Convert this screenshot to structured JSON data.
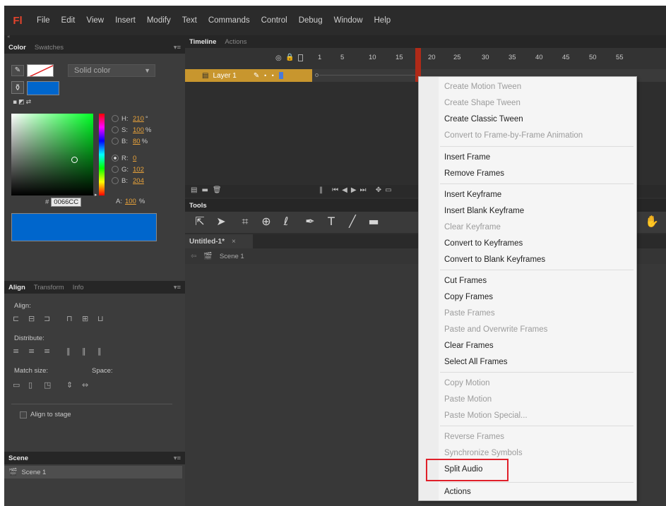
{
  "app": {
    "logo": "Fl"
  },
  "menubar": [
    "File",
    "Edit",
    "View",
    "Insert",
    "Modify",
    "Text",
    "Commands",
    "Control",
    "Debug",
    "Window",
    "Help"
  ],
  "color_panel": {
    "tabs": [
      "Color",
      "Swatches"
    ],
    "type": "Solid color",
    "hsb": [
      {
        "label": "H:",
        "value": "210",
        "unit": "°"
      },
      {
        "label": "S:",
        "value": "100",
        "unit": "%"
      },
      {
        "label": "B:",
        "value": "80",
        "unit": "%"
      }
    ],
    "rgb": [
      {
        "label": "R:",
        "value": "0"
      },
      {
        "label": "G:",
        "value": "102"
      },
      {
        "label": "B:",
        "value": "204"
      }
    ],
    "hex_label": "#",
    "hex": "0066CC",
    "alpha_label": "A:",
    "alpha": "100",
    "alpha_unit": "%",
    "fill_color": "#0066cc"
  },
  "align_panel": {
    "tabs": [
      "Align",
      "Transform",
      "Info"
    ],
    "align_label": "Align:",
    "distribute_label": "Distribute:",
    "match_label": "Match size:",
    "space_label": "Space:",
    "align_to_stage": "Align to stage"
  },
  "scene_panel": {
    "tab": "Scene",
    "items": [
      "Scene 1"
    ]
  },
  "timeline": {
    "tabs": [
      "Timeline",
      "Actions"
    ],
    "frame_numbers": [
      "1",
      "5",
      "10",
      "15",
      "20",
      "25",
      "30",
      "35",
      "40",
      "45",
      "50",
      "55"
    ],
    "layer_name": "Layer 1",
    "layer_color": "#c8962e"
  },
  "tools": {
    "tab": "Tools"
  },
  "document": {
    "tab": "Untitled-1*",
    "close": "×",
    "scene": "Scene 1"
  },
  "context_menu": {
    "groups": [
      [
        {
          "label": "Create Motion Tween",
          "enabled": false
        },
        {
          "label": "Create Shape Tween",
          "enabled": false
        },
        {
          "label": "Create Classic Tween",
          "enabled": true
        },
        {
          "label": "Convert to Frame-by-Frame Animation",
          "enabled": false
        }
      ],
      [
        {
          "label": "Insert Frame",
          "enabled": true
        },
        {
          "label": "Remove Frames",
          "enabled": true
        }
      ],
      [
        {
          "label": "Insert Keyframe",
          "enabled": true
        },
        {
          "label": "Insert Blank Keyframe",
          "enabled": true
        },
        {
          "label": "Clear Keyframe",
          "enabled": false
        },
        {
          "label": "Convert to Keyframes",
          "enabled": true
        },
        {
          "label": "Convert to Blank Keyframes",
          "enabled": true
        }
      ],
      [
        {
          "label": "Cut Frames",
          "enabled": true
        },
        {
          "label": "Copy Frames",
          "enabled": true
        },
        {
          "label": "Paste Frames",
          "enabled": false
        },
        {
          "label": "Paste and Overwrite Frames",
          "enabled": false
        },
        {
          "label": "Clear Frames",
          "enabled": true
        },
        {
          "label": "Select All Frames",
          "enabled": true
        }
      ],
      [
        {
          "label": "Copy Motion",
          "enabled": false
        },
        {
          "label": "Paste Motion",
          "enabled": false
        },
        {
          "label": "Paste Motion Special...",
          "enabled": false
        }
      ],
      [
        {
          "label": "Reverse Frames",
          "enabled": false
        },
        {
          "label": "Synchronize Symbols",
          "enabled": false
        },
        {
          "label": "Split Audio",
          "enabled": true,
          "highlighted": true
        }
      ],
      [
        {
          "label": "Actions",
          "enabled": true
        }
      ]
    ],
    "highlight_color": "#e0202a"
  }
}
